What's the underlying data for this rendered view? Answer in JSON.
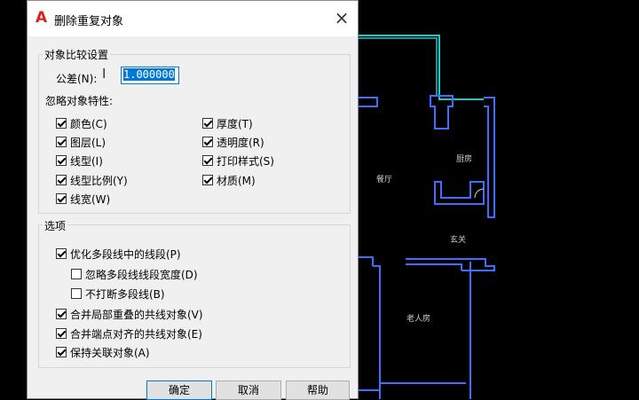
{
  "dialog": {
    "title": "删除重复对象",
    "close_glyph": "×",
    "app_icon_glyph": "A",
    "compare_group": {
      "label": "对象比较设置",
      "tolerance_label": "公差(N):",
      "tolerance_value": "1.000000",
      "ignore_label": "忽略对象特性:",
      "properties_left": [
        {
          "label": "颜色(C)",
          "checked": true
        },
        {
          "label": "图层(L)",
          "checked": true
        },
        {
          "label": "线型(I)",
          "checked": true
        },
        {
          "label": "线型比例(Y)",
          "checked": true
        },
        {
          "label": "线宽(W)",
          "checked": true
        }
      ],
      "properties_right": [
        {
          "label": "厚度(T)",
          "checked": true
        },
        {
          "label": "透明度(R)",
          "checked": true
        },
        {
          "label": "打印样式(S)",
          "checked": true
        },
        {
          "label": "材质(M)",
          "checked": true
        }
      ]
    },
    "options_group": {
      "label": "选项",
      "optimize_polyline": {
        "label": "优化多段线中的线段(P)",
        "checked": true
      },
      "ignore_width": {
        "label": "忽略多段线线段宽度(D)",
        "checked": false
      },
      "no_break": {
        "label": "不打断多段线(B)",
        "checked": false
      },
      "merge_overlap": {
        "label": "合并局部重叠的共线对象(V)",
        "checked": true
      },
      "merge_endpoint": {
        "label": "合并端点对齐的共线对象(E)",
        "checked": true
      },
      "keep_assoc": {
        "label": "保持关联对象(A)",
        "checked": true
      }
    },
    "buttons": {
      "ok": "确定",
      "cancel": "取消",
      "help": "帮助"
    }
  },
  "cad_labels": {
    "living": "餐厅",
    "kitchen": "厨房",
    "entry": "玄关",
    "elder_room": "老人房"
  },
  "colors": {
    "wall_blue": "#3f6dff",
    "wall_cyan": "#19c8c8",
    "dialog_bg": "#f0f0f0",
    "accent": "#0078d7"
  }
}
